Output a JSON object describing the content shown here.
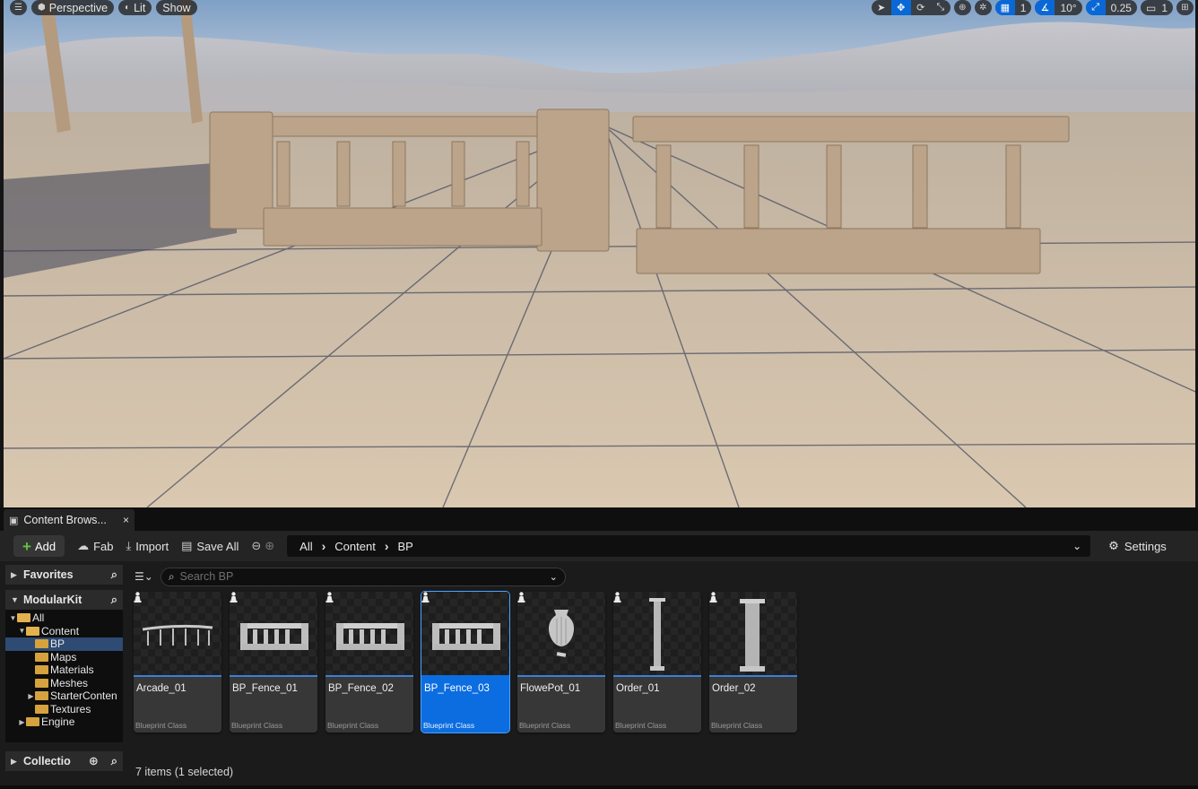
{
  "viewport": {
    "menu_icon": "hamburger-icon",
    "perspective_label": "Perspective",
    "lit_label": "Lit",
    "show_label": "Show",
    "grid_snap_value": "1",
    "rotation_snap_value": "10°",
    "scale_snap_value": "0.25",
    "camera_speed_value": "1"
  },
  "tab": {
    "title": "Content Brows...",
    "close": "×"
  },
  "toolbar": {
    "add_label": "Add",
    "fab_label": "Fab",
    "import_label": "Import",
    "save_all_label": "Save All",
    "settings_label": "Settings"
  },
  "breadcrumb": [
    "All",
    "Content",
    "BP"
  ],
  "sidebar": {
    "favorites_label": "Favorites",
    "project_label": "ModularKit",
    "collections_label": "Collectio",
    "tree": [
      {
        "label": "All",
        "depth": 0,
        "expanded": true,
        "selected": false
      },
      {
        "label": "Content",
        "depth": 1,
        "expanded": true,
        "selected": false
      },
      {
        "label": "BP",
        "depth": 2,
        "expanded": false,
        "selected": true
      },
      {
        "label": "Maps",
        "depth": 2,
        "expanded": false,
        "selected": false
      },
      {
        "label": "Materials",
        "depth": 2,
        "expanded": false,
        "selected": false
      },
      {
        "label": "Meshes",
        "depth": 2,
        "expanded": false,
        "selected": false
      },
      {
        "label": "StarterConten",
        "depth": 2,
        "expanded": false,
        "selected": false,
        "has_children": true
      },
      {
        "label": "Textures",
        "depth": 2,
        "expanded": false,
        "selected": false
      },
      {
        "label": "Engine",
        "depth": 1,
        "expanded": false,
        "selected": false,
        "has_children": true
      }
    ]
  },
  "search": {
    "placeholder": "Search BP"
  },
  "assets": [
    {
      "name": "Arcade_01",
      "type": "Blueprint Class",
      "thumb": "arcade",
      "selected": false
    },
    {
      "name": "BP_Fence_01",
      "type": "Blueprint Class",
      "thumb": "fence",
      "selected": false
    },
    {
      "name": "BP_Fence_02",
      "type": "Blueprint Class",
      "thumb": "fence",
      "selected": false
    },
    {
      "name": "BP_Fence_03",
      "type": "Blueprint Class",
      "thumb": "fence",
      "selected": true
    },
    {
      "name": "FlowePot_01",
      "type": "Blueprint Class",
      "thumb": "vase",
      "selected": false
    },
    {
      "name": "Order_01",
      "type": "Blueprint Class",
      "thumb": "column",
      "selected": false
    },
    {
      "name": "Order_02",
      "type": "Blueprint Class",
      "thumb": "column-thick",
      "selected": false
    }
  ],
  "status": {
    "items_text": "7 items (1 selected)"
  },
  "colors": {
    "accent": "#0b6de0",
    "folder": "#d6a23d",
    "add_plus": "#5fc43f",
    "panel_bg": "#1b1b1b"
  }
}
